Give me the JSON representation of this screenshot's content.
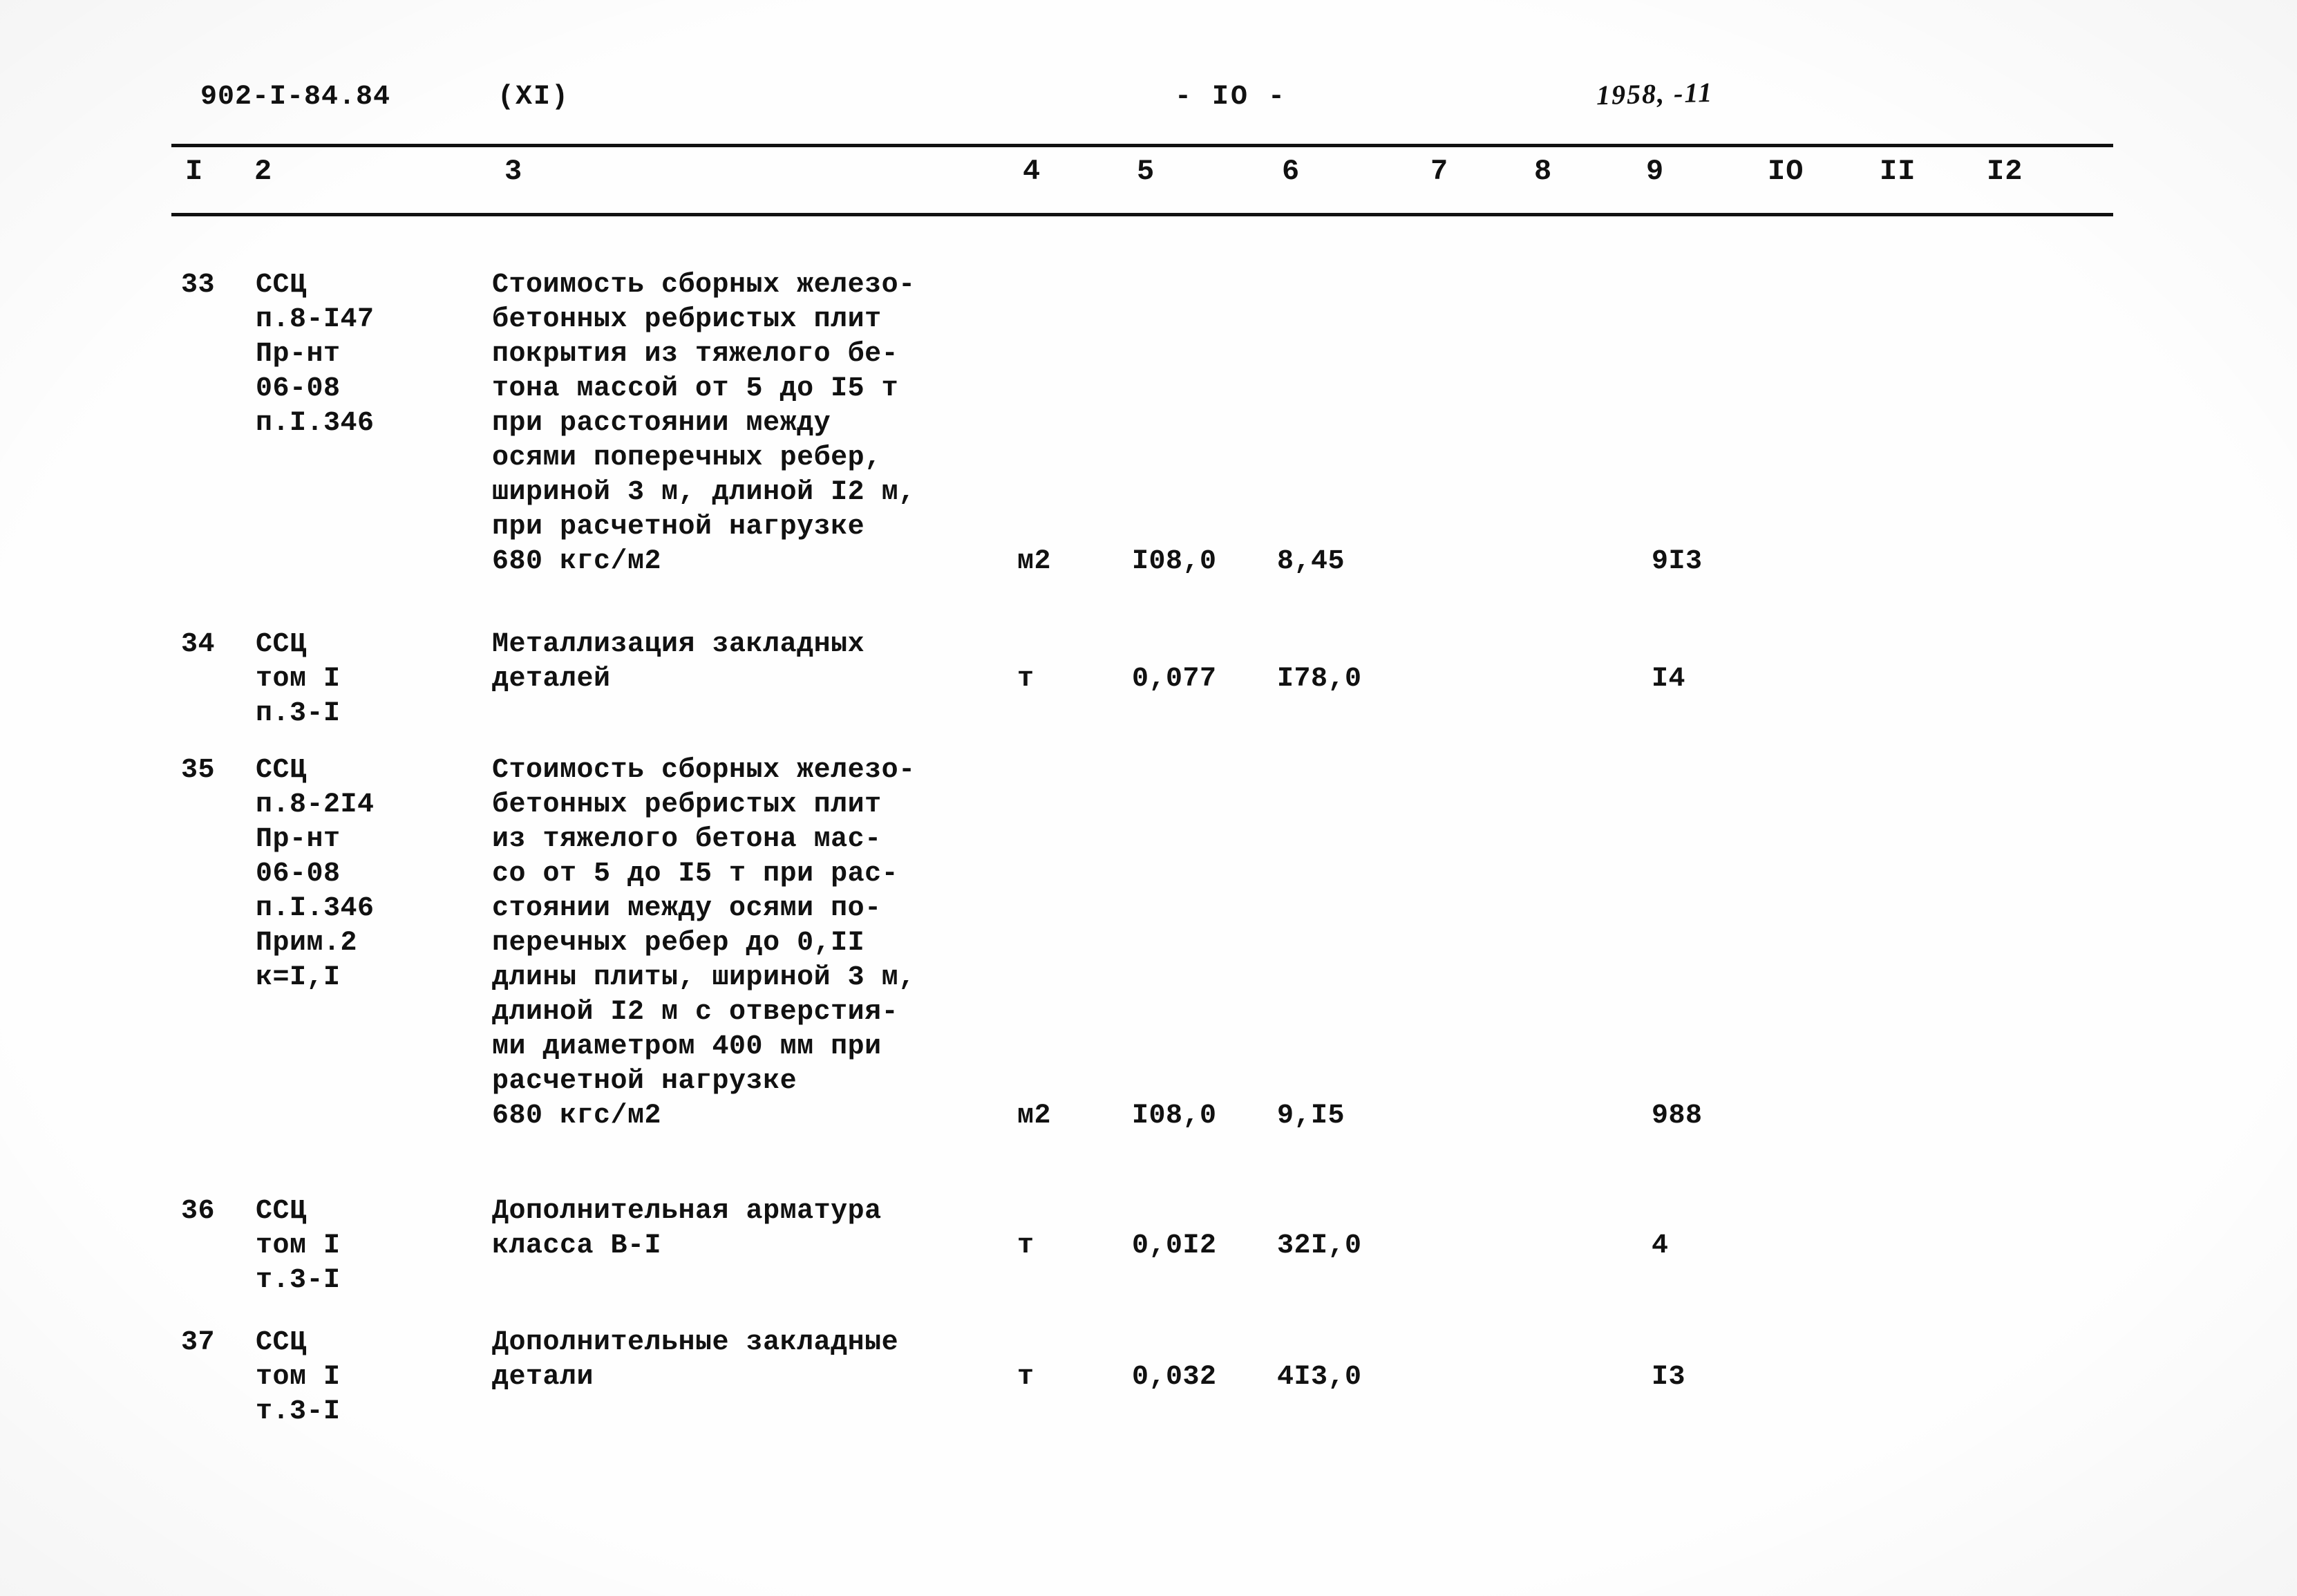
{
  "header": {
    "doc_code": "902-I-84.84",
    "part": "(XI)",
    "page_number": "- IO -",
    "handwritten_note": "1958, -11"
  },
  "table": {
    "column_numbers": [
      "I",
      "2",
      "3",
      "4",
      "5",
      "6",
      "7",
      "8",
      "9",
      "IO",
      "II",
      "I2"
    ],
    "rows": [
      {
        "num": "33",
        "ref": "ССЦ\nп.8-I47\nПр-нт\n06-08\nп.I.346",
        "desc": "Стоимость сборных железо-\nбетонных ребристых плит\nпокрытия из тяжелого бе-\nтона массой от 5 до I5 т\nпри расстоянии между\nосями поперечных ребер,\nшириной 3 м, длиной I2 м,\nпри расчетной нагрузке\n680 кгс/м2",
        "unit": "м2",
        "qty": "I08,0",
        "price": "8,45",
        "total": "9I3",
        "value_line_offset": 8
      },
      {
        "num": "34",
        "ref": "ССЦ\nтом I\nп.3-I",
        "desc": "Металлизация закладных\nдеталей",
        "unit": "т",
        "qty": "0,077",
        "price": "I78,0",
        "total": "I4",
        "value_line_offset": 1
      },
      {
        "num": "35",
        "ref": "ССЦ\nп.8-2I4\nПр-нт\n06-08\nп.I.346\nПрим.2\nк=I,I",
        "desc": "Стоимость сборных железо-\nбетонных ребристых плит\nиз тяжелого бетона мас-\nсо от 5 до I5 т при рас-\nстоянии между осями по-\nперечных ребер до 0,II\nдлины плиты, шириной 3 м,\nдлиной I2 м с отверстия-\nми диаметром 400 мм при\nрасчетной нагрузке\n680 кгс/м2",
        "unit": "м2",
        "qty": "I08,0",
        "price": "9,I5",
        "total": "988",
        "value_line_offset": 10
      },
      {
        "num": "36",
        "ref": "ССЦ\nтом I\nт.3-I",
        "desc": "Дополнительная арматура\nкласса B-I",
        "unit": "т",
        "qty": "0,0I2",
        "price": "32I,0",
        "total": "4",
        "value_line_offset": 1
      },
      {
        "num": "37",
        "ref": "ССЦ\nтом I\nт.3-I",
        "desc": "Дополнительные закладные\nдетали",
        "unit": "т",
        "qty": "0,032",
        "price": "4I3,0",
        "total": "I3",
        "value_line_offset": 1
      }
    ]
  }
}
